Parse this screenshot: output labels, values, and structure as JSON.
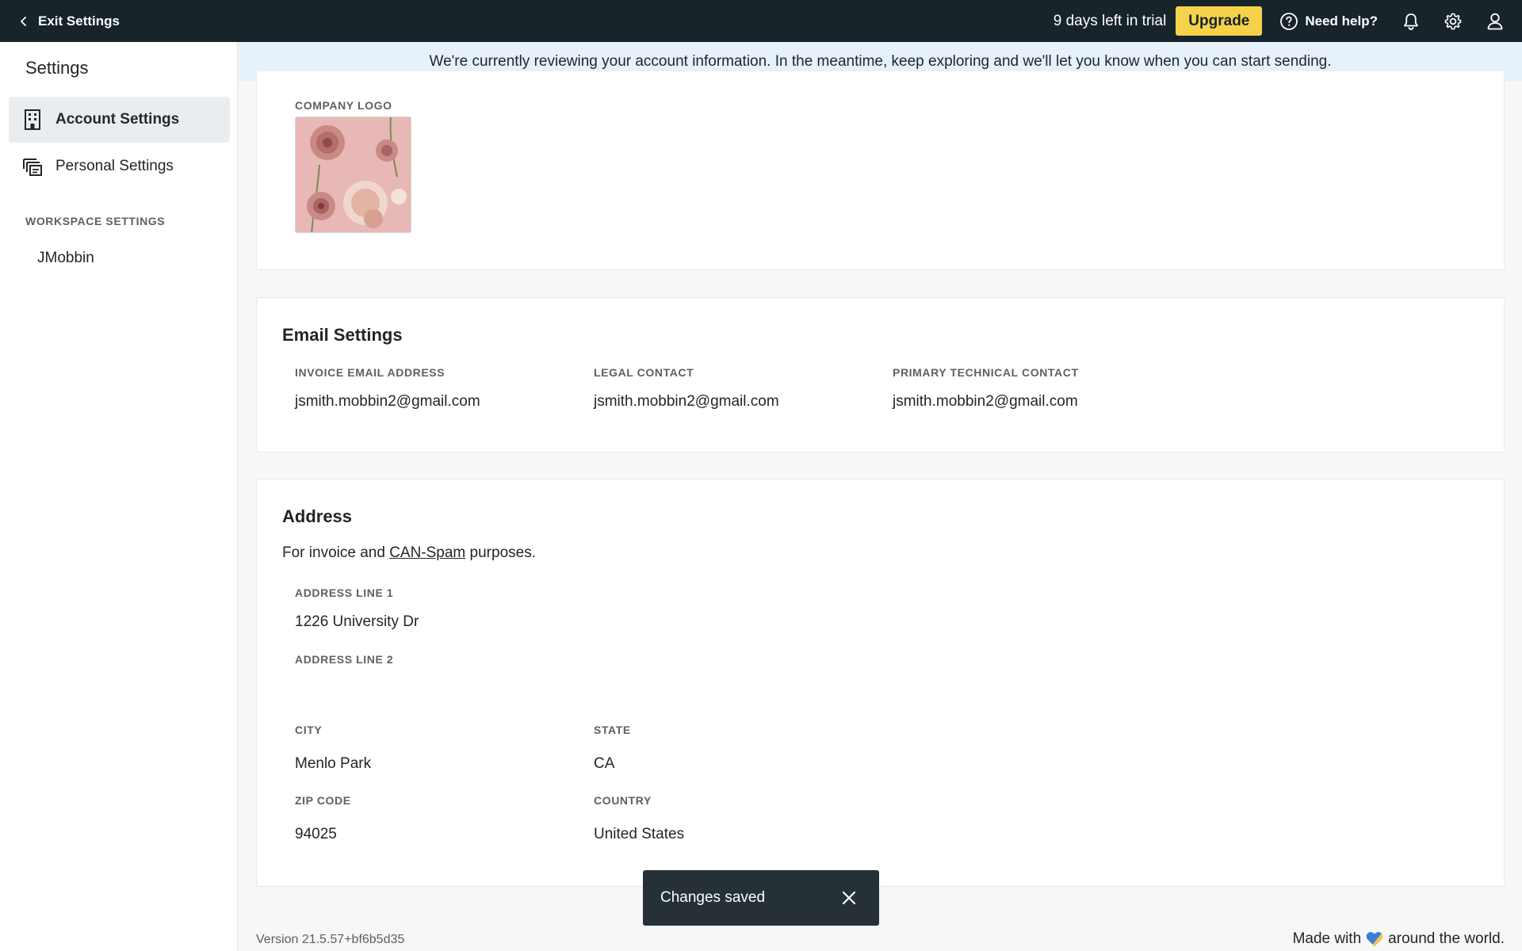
{
  "topbar": {
    "exit_label": "Exit Settings",
    "trial_text": "9 days left in trial",
    "upgrade_label": "Upgrade",
    "help_label": "Need help?"
  },
  "sidebar": {
    "title": "Settings",
    "items": [
      {
        "label": "Account Settings",
        "icon": "building-icon",
        "active": true
      },
      {
        "label": "Personal Settings",
        "icon": "cards-icon",
        "active": false
      }
    ],
    "section_label": "WORKSPACE SETTINGS",
    "workspace": "JMobbin"
  },
  "banner": {
    "text": "We're currently reviewing your account information. In the meantime, keep exploring and we'll let you know when you can start sending."
  },
  "logo_card": {
    "label": "COMPANY LOGO"
  },
  "email_card": {
    "title": "Email Settings",
    "fields": [
      {
        "label": "INVOICE EMAIL ADDRESS",
        "value": "jsmith.mobbin2@gmail.com"
      },
      {
        "label": "LEGAL CONTACT",
        "value": "jsmith.mobbin2@gmail.com"
      },
      {
        "label": "PRIMARY TECHNICAL CONTACT",
        "value": "jsmith.mobbin2@gmail.com"
      }
    ]
  },
  "address_card": {
    "title": "Address",
    "desc_prefix": "For invoice and ",
    "desc_link": "CAN-Spam",
    "desc_suffix": " purposes.",
    "line1_label": "ADDRESS LINE 1",
    "line1_value": "1226 University Dr",
    "line2_label": "ADDRESS LINE 2",
    "line2_value": "",
    "city_label": "CITY",
    "city_value": "Menlo Park",
    "state_label": "STATE",
    "state_value": "CA",
    "zip_label": "ZIP CODE",
    "zip_value": "94025",
    "country_label": "COUNTRY",
    "country_value": "United States"
  },
  "footer": {
    "version": "Version 21.5.57+bf6b5d35",
    "made_prefix": "Made with",
    "made_suffix": "around the world."
  },
  "toast": {
    "text": "Changes saved"
  },
  "colors": {
    "topbar_bg": "#17242a",
    "upgrade_bg": "#f6d24a",
    "banner_bg": "#e7f1fb",
    "toast_bg": "#253137",
    "heart_blue": "#3b7dd8",
    "heart_yellow": "#f2c744"
  }
}
